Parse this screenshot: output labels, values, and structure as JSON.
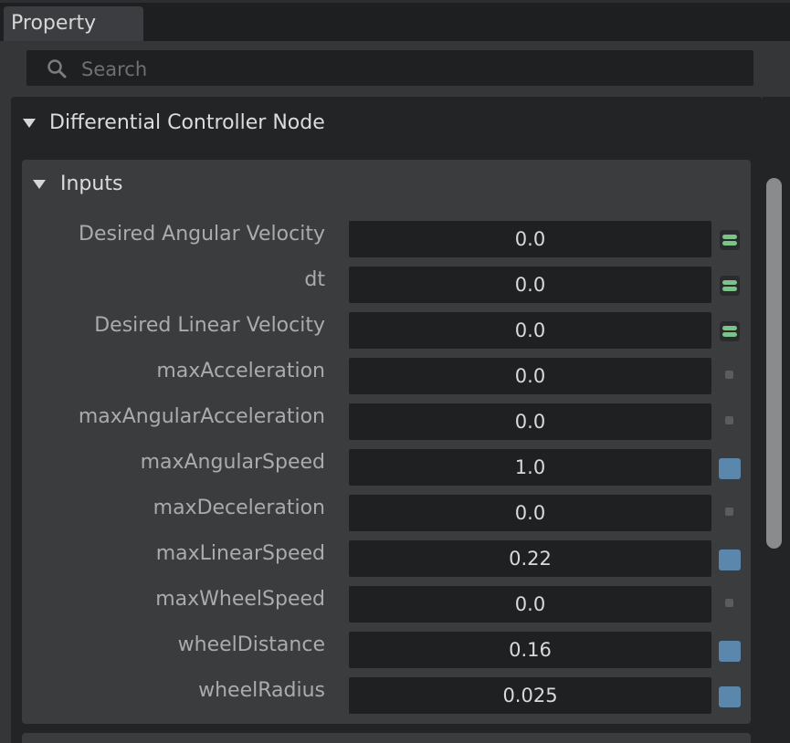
{
  "tab": {
    "label": "Property"
  },
  "search": {
    "placeholder": "Search",
    "value": ""
  },
  "node": {
    "title": "Differential Controller Node",
    "inputs": {
      "title": "Inputs",
      "rows": [
        {
          "label": "Desired Angular Velocity",
          "value": "0.0",
          "indicator": "connected"
        },
        {
          "label": "dt",
          "value": "0.0",
          "indicator": "connected"
        },
        {
          "label": "Desired Linear Velocity",
          "value": "0.0",
          "indicator": "connected"
        },
        {
          "label": "maxAcceleration",
          "value": "0.0",
          "indicator": "default"
        },
        {
          "label": "maxAngularAcceleration",
          "value": "0.0",
          "indicator": "default"
        },
        {
          "label": "maxAngularSpeed",
          "value": "1.0",
          "indicator": "modified"
        },
        {
          "label": "maxDeceleration",
          "value": "0.0",
          "indicator": "default"
        },
        {
          "label": "maxLinearSpeed",
          "value": "0.22",
          "indicator": "modified"
        },
        {
          "label": "maxWheelSpeed",
          "value": "0.0",
          "indicator": "default"
        },
        {
          "label": "wheelDistance",
          "value": "0.16",
          "indicator": "modified"
        },
        {
          "label": "wheelRadius",
          "value": "0.025",
          "indicator": "modified"
        }
      ]
    }
  },
  "colors": {
    "background": "#343638",
    "field": "#1f2021",
    "connected_indicator": "#7cc38a",
    "modified_indicator": "#5b87ad",
    "label_text": "#a9abad"
  },
  "icons": {
    "search": "search-icon",
    "collapse": "triangle-down-icon",
    "connected": "connection-icon",
    "modified": "modified-square-icon",
    "default": "default-dot-icon"
  }
}
